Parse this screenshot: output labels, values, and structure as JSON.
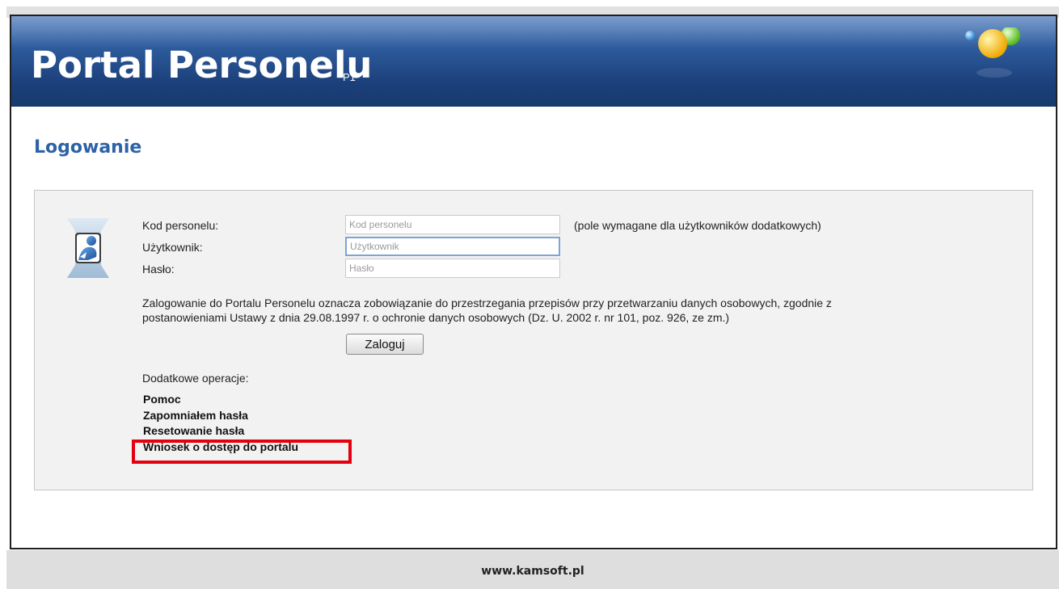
{
  "header": {
    "title": "Portal Personelu",
    "subtitle": "P1"
  },
  "page_heading": "Logowanie",
  "form": {
    "personnel_code": {
      "label": "Kod personelu:",
      "placeholder": "Kod personelu",
      "value": ""
    },
    "personnel_code_hint": "(pole wymagane dla użytkowników dodatkowych)",
    "user": {
      "label": "Użytkownik:",
      "placeholder": "Użytkownik",
      "value": ""
    },
    "password": {
      "label": "Hasło:",
      "placeholder": "Hasło",
      "value": ""
    },
    "notice_line1": "Zalogowanie do Portalu Personelu oznacza zobowiązanie do przestrzegania przepisów przy przetwarzaniu danych osobowych, zgodnie z",
    "notice_line2": "postanowieniami Ustawy z dnia 29.08.1997 r. o ochronie danych osobowych (Dz. U. 2002 r. nr 101, poz. 926, ze zm.)",
    "login_button": "Zaloguj"
  },
  "extra": {
    "title": "Dodatkowe operacje:",
    "links": [
      "Pomoc",
      "Zapomniałem hasła",
      "Resetowanie hasła",
      "Wniosek o dostęp do portalu"
    ]
  },
  "footer": {
    "text": "www.kamsoft.pl"
  },
  "colors": {
    "header_dark": "#1b3f7a",
    "heading": "#2e62a6",
    "highlight": "#e3000f",
    "panel_bg": "#f2f2f2"
  }
}
